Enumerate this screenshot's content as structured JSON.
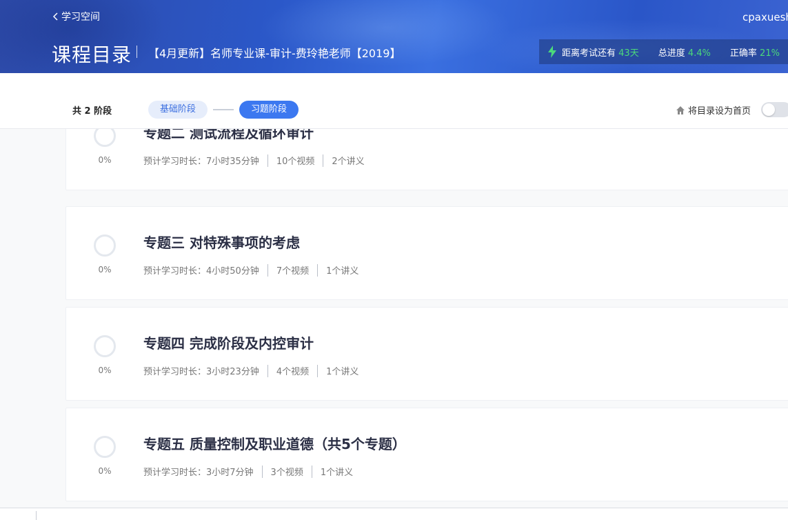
{
  "header": {
    "back_label": "学习空间",
    "username": "cpaxueshu",
    "page_title": "课程目录",
    "course_name": "【4月更新】名师专业课-审计-费玲艳老师【2019】",
    "stats": {
      "exam_label": "距离考试还有",
      "exam_value": "43天",
      "progress_label": "总进度",
      "progress_value": "4.4%",
      "accuracy_label": "正确率",
      "accuracy_value": "21%"
    }
  },
  "stages": {
    "count_label": "共 2 阶段",
    "items": [
      {
        "label": "基础阶段",
        "active": false
      },
      {
        "label": "习题阶段",
        "active": true
      }
    ],
    "home_setting_label": "将目录设为首页",
    "home_toggle_on": false
  },
  "topics": [
    {
      "title": "专题二 测试流程及循环审计",
      "percent": "0%",
      "duration": "预计学习时长：7小时35分钟",
      "videos": "10个视频",
      "handouts": "2个讲义"
    },
    {
      "title": "专题三 对特殊事项的考虑",
      "percent": "0%",
      "duration": "预计学习时长：4小时50分钟",
      "videos": "7个视频",
      "handouts": "1个讲义"
    },
    {
      "title": "专题四 完成阶段及内控审计",
      "percent": "0%",
      "duration": "预计学习时长：3小时23分钟",
      "videos": "4个视频",
      "handouts": "1个讲义"
    },
    {
      "title": "专题五 质量控制及职业道德（共5个专题）",
      "percent": "0%",
      "duration": "预计学习时长：3小时7分钟",
      "videos": "3个视频",
      "handouts": "1个讲义"
    }
  ],
  "colors": {
    "accent": "#3c78f0",
    "success": "#4cd97b"
  }
}
